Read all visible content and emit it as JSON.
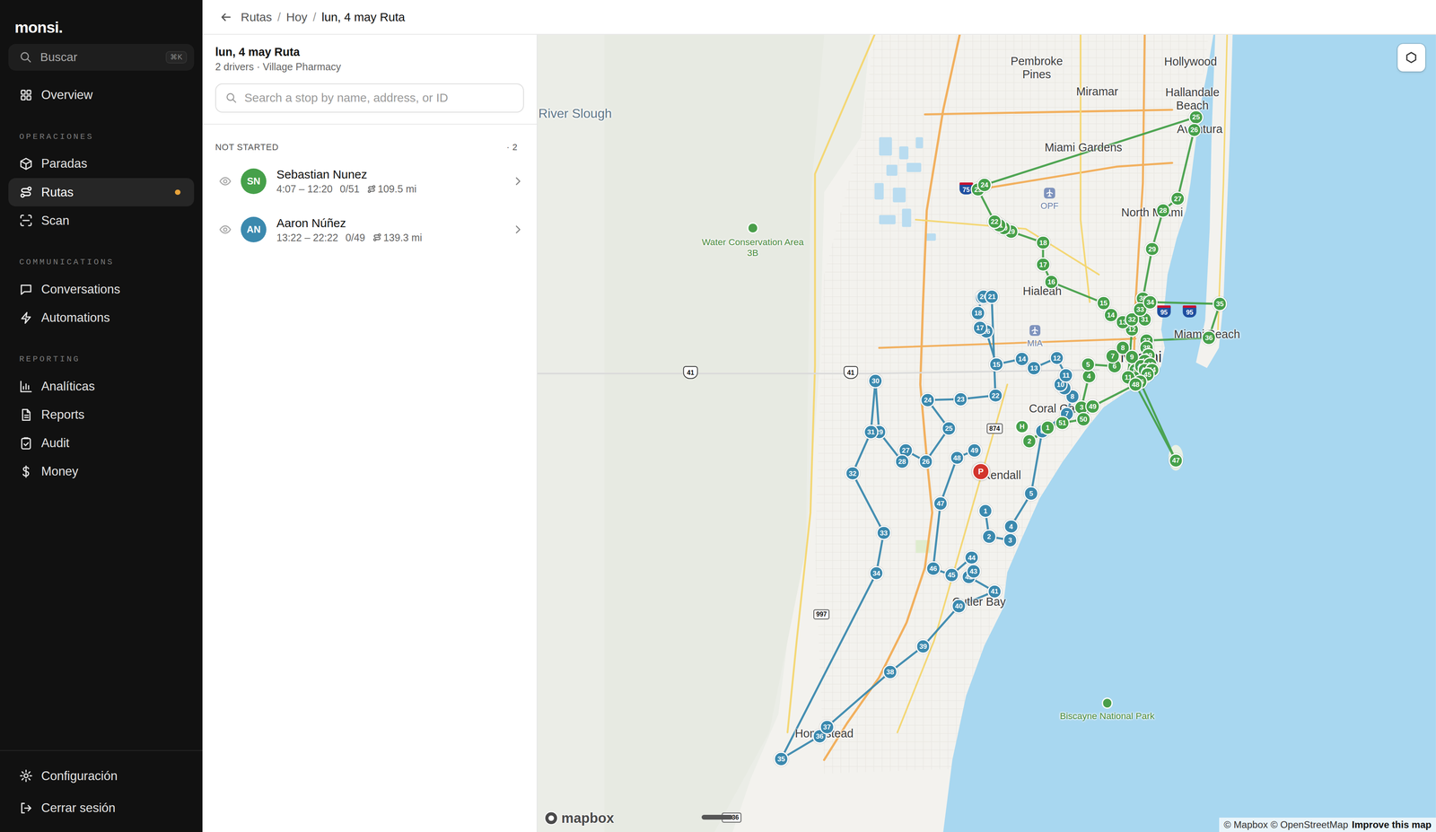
{
  "sidebar": {
    "logo": "monsi.",
    "search": {
      "placeholder": "Buscar",
      "shortcut": "⌘K"
    },
    "top_items": [
      {
        "label": "Overview",
        "selected": false,
        "notify": false
      }
    ],
    "sections": [
      {
        "heading": "OPERACIONES",
        "items": [
          {
            "label": "Paradas",
            "selected": false,
            "notify": false
          },
          {
            "label": "Rutas",
            "selected": true,
            "notify": true
          },
          {
            "label": "Scan",
            "selected": false,
            "notify": false
          }
        ]
      },
      {
        "heading": "COMMUNICATIONS",
        "items": [
          {
            "label": "Conversations",
            "selected": false,
            "notify": false
          },
          {
            "label": "Automations",
            "selected": false,
            "notify": false
          }
        ]
      },
      {
        "heading": "REPORTING",
        "items": [
          {
            "label": "Analíticas",
            "selected": false,
            "notify": false
          },
          {
            "label": "Reports",
            "selected": false,
            "notify": false
          },
          {
            "label": "Audit",
            "selected": false,
            "notify": false
          },
          {
            "label": "Money",
            "selected": false,
            "notify": false
          }
        ]
      }
    ],
    "footer_items": [
      {
        "label": "Configuración"
      },
      {
        "label": "Cerrar sesión"
      }
    ]
  },
  "breadcrumb": {
    "separator": "/",
    "items": [
      "Rutas",
      "Hoy",
      "lun, 4 may Ruta"
    ]
  },
  "route": {
    "title": "lun, 4 may Ruta",
    "subtitle": "2 drivers · Village Pharmacy"
  },
  "stop_search": {
    "placeholder": "Search a stop by name, address, or ID"
  },
  "group": {
    "label": "NOT STARTED",
    "count": "· 2"
  },
  "drivers": [
    {
      "initials": "SN",
      "name": "Sebastian Nunez",
      "time": "4:07 – 12:20",
      "progress": "0/51",
      "distance": "109.5 mi",
      "color": "#46a04a"
    },
    {
      "initials": "AN",
      "name": "Aaron Núñez",
      "time": "13:22 – 22:22",
      "progress": "0/49",
      "distance": "139.3 mi",
      "color": "#3b89ae"
    }
  ],
  "map": {
    "labels": [
      {
        "text": "River Slough",
        "kind": "water"
      },
      {
        "text": "Pembroke Pines",
        "kind": "place"
      },
      {
        "text": "Hollywood",
        "kind": "place"
      },
      {
        "text": "Miramar",
        "kind": "place"
      },
      {
        "text": "Hallandale Beach",
        "kind": "place"
      },
      {
        "text": "Aventura",
        "kind": "place"
      },
      {
        "text": "Miami Gardens",
        "kind": "place"
      },
      {
        "text": "North Miami",
        "kind": "place"
      },
      {
        "text": "Hialeah",
        "kind": "place"
      },
      {
        "text": "Miami Beach",
        "kind": "place"
      },
      {
        "text": "Miami",
        "kind": "city"
      },
      {
        "text": "Coral Gables",
        "kind": "place"
      },
      {
        "text": "Kendall",
        "kind": "place"
      },
      {
        "text": "Cutler Bay",
        "kind": "place"
      },
      {
        "text": "Homestead",
        "kind": "place"
      },
      {
        "text": "Water Conservation Area 3B",
        "kind": "park"
      },
      {
        "text": "Biscayne National Park",
        "kind": "park"
      },
      {
        "text": "OPF",
        "kind": "airport"
      },
      {
        "text": "MIA",
        "kind": "airport"
      }
    ],
    "shields": [
      {
        "text": "75",
        "kind": "interstate"
      },
      {
        "text": "95",
        "kind": "interstate"
      },
      {
        "text": "95",
        "kind": "interstate"
      },
      {
        "text": "41",
        "kind": "us"
      },
      {
        "text": "41",
        "kind": "us"
      },
      {
        "text": "874",
        "kind": "state"
      },
      {
        "text": "997",
        "kind": "state"
      },
      {
        "text": "9336",
        "kind": "state"
      }
    ],
    "routes": [
      {
        "color": "#46a04a",
        "stops": [
          "1",
          "2",
          "3",
          "4",
          "5",
          "6",
          "7",
          "8",
          "9",
          "10",
          "11",
          "12",
          "13",
          "14",
          "15",
          "16",
          "17",
          "18",
          "19",
          "20",
          "21",
          "22",
          "23",
          "24",
          "25",
          "26",
          "27",
          "28",
          "29",
          "30",
          "31",
          "32",
          "33",
          "34",
          "35",
          "36",
          "37",
          "38",
          "39",
          "40",
          "41",
          "42",
          "43",
          "44",
          "45",
          "46",
          "47",
          "48",
          "49",
          "50",
          "51"
        ]
      },
      {
        "color": "#3b89ae",
        "stops": [
          "1",
          "2",
          "3",
          "4",
          "5",
          "6",
          "7",
          "8",
          "9",
          "10",
          "11",
          "12",
          "13",
          "14",
          "15",
          "16",
          "17",
          "18",
          "19",
          "20",
          "21",
          "22",
          "23",
          "24",
          "25",
          "26",
          "27",
          "28",
          "29",
          "30",
          "31",
          "32",
          "33",
          "34",
          "35",
          "36",
          "37",
          "38",
          "39",
          "40",
          "41",
          "42",
          "43",
          "44",
          "45",
          "46",
          "47",
          "48",
          "49"
        ]
      }
    ],
    "depot": "P",
    "home": "H",
    "logo": "mapbox",
    "attribution": {
      "text": "© Mapbox © OpenStreetMap",
      "link": "Improve this map"
    }
  }
}
